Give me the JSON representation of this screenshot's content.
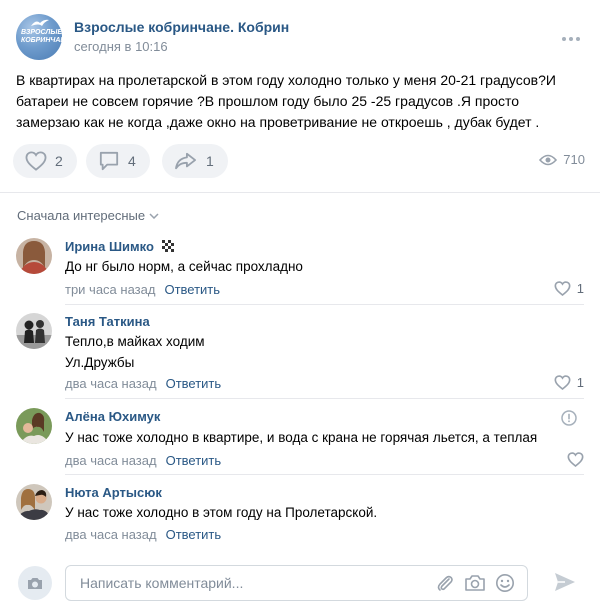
{
  "post": {
    "group_name": "Взрослые кобринчане. Кобрин",
    "time": "сегодня в 10:16",
    "avatar_text": "ВЗРОСЛЫЕ КОБРИНЧАНЕ",
    "text": "В квартирах на пролетарской в этом году холодно только у меня 20-21 градусов?И батареи не совсем горячие ?В прошлом году было 25 -25 градусов .Я просто замерзаю как не когда ,даже окно на проветривание не откроешь , дубак будет .",
    "likes": "2",
    "comments": "4",
    "shares": "1",
    "views": "710"
  },
  "sort_label": "Сначала интересные",
  "comments": [
    {
      "author": "Ирина Шимко",
      "text_lines": [
        "До нг было норм, а сейчас прохладно"
      ],
      "time": "три часа назад",
      "reply": "Ответить",
      "likes": "1"
    },
    {
      "author": "Таня Таткина",
      "text_lines": [
        "Тепло,в майках ходим",
        "Ул.Дружбы"
      ],
      "time": "два часа назад",
      "reply": "Ответить",
      "likes": "1"
    },
    {
      "author": "Алёна Юхимук",
      "text_lines": [
        "У нас тоже холодно в квартире, и вода с крана не горячая льется, а теплая"
      ],
      "time": "два часа назад",
      "reply": "Ответить",
      "likes": ""
    },
    {
      "author": "Нюта Артысюк",
      "text_lines": [
        "У нас тоже холодно в этом году на Пролетарской."
      ],
      "time": "два часа назад",
      "reply": "Ответить",
      "likes": ""
    }
  ],
  "composer": {
    "placeholder": "Написать комментарий..."
  },
  "icons": {
    "more": "more-dots-icon",
    "like": "heart-icon",
    "comment": "comment-bubble-icon",
    "share": "share-arrow-icon",
    "views": "eye-icon",
    "chevron": "chevron-down-icon",
    "attach": "paperclip-icon",
    "photo": "camera-icon",
    "emoji": "smile-icon",
    "send": "send-arrow-icon",
    "report": "exclamation-circle-icon",
    "badge": "checkered-flag-icon"
  },
  "colors": {
    "link": "#2a5885",
    "muted": "#818c99",
    "button_bg": "#f0f2f5",
    "icon": "#99a2ad"
  }
}
